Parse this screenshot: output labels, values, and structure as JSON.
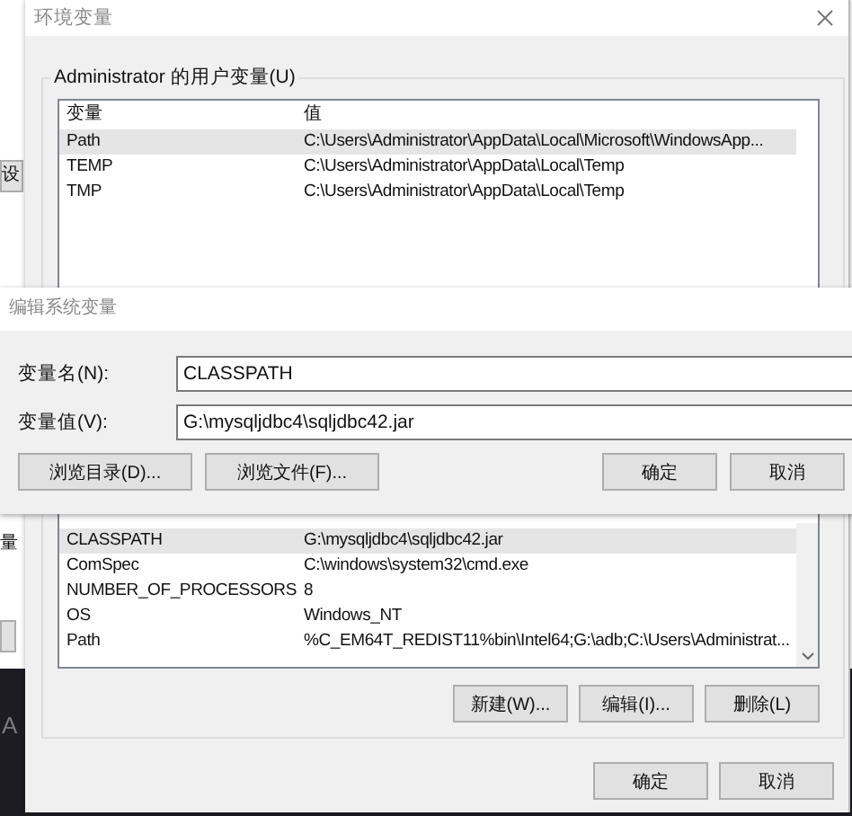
{
  "background_window": {
    "button_label": "设",
    "label": "量",
    "terminal_text": "A"
  },
  "window": {
    "title": "环境变量",
    "user_variables": {
      "label": "Administrator 的用户变量(U)",
      "columns": [
        "变量",
        "值"
      ],
      "rows": [
        {
          "name": "Path",
          "value": "C:\\Users\\Administrator\\AppData\\Local\\Microsoft\\WindowsApp...",
          "selected": true
        },
        {
          "name": "TEMP",
          "value": "C:\\Users\\Administrator\\AppData\\Local\\Temp",
          "selected": false
        },
        {
          "name": "TMP",
          "value": "C:\\Users\\Administrator\\AppData\\Local\\Temp",
          "selected": false
        }
      ]
    },
    "system_variables": {
      "rows": [
        {
          "name": "CLASSPATH",
          "value": "G:\\mysqljdbc4\\sqljdbc42.jar",
          "selected": true
        },
        {
          "name": "ComSpec",
          "value": "C:\\windows\\system32\\cmd.exe",
          "selected": false
        },
        {
          "name": "NUMBER_OF_PROCESSORS",
          "value": "8",
          "selected": false
        },
        {
          "name": "OS",
          "value": "Windows_NT",
          "selected": false
        },
        {
          "name": "Path",
          "value": "%C_EM64T_REDIST11%bin\\Intel64;G:\\adb;C:\\Users\\Administrat...",
          "selected": false
        }
      ],
      "buttons": [
        "新建(W)...",
        "编辑(I)...",
        "删除(L)"
      ]
    },
    "buttons": [
      "确定",
      "取消"
    ]
  },
  "edit_dialog": {
    "title": "编辑系统变量",
    "fields": [
      {
        "label": "变量名(N):",
        "value": "CLASSPATH"
      },
      {
        "label": "变量值(V):",
        "value": "G:\\mysqljdbc4\\sqljdbc42.jar"
      }
    ],
    "left_buttons": [
      "浏览目录(D)...",
      "浏览文件(F)..."
    ],
    "right_buttons": [
      "确定",
      "取消"
    ]
  }
}
